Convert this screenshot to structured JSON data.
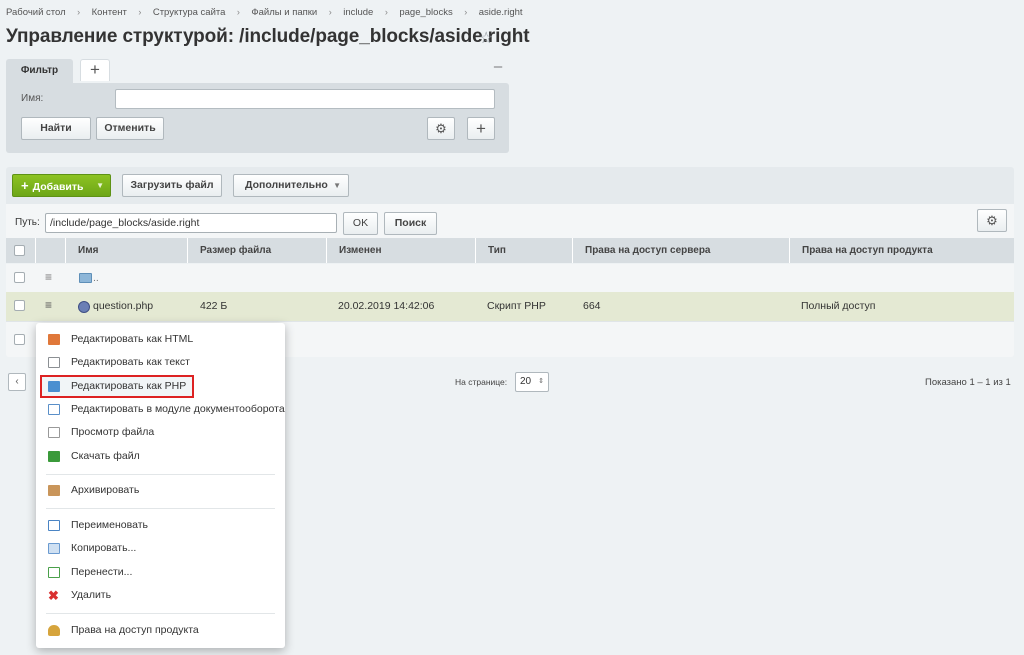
{
  "breadcrumbs": [
    "Рабочий стол",
    "Контент",
    "Структура сайта",
    "Файлы и папки",
    "include",
    "page_blocks",
    "aside.right"
  ],
  "page_title": "Управление структурой: /include/page_blocks/aside.right",
  "star_icon": "☆",
  "filter": {
    "tab_label": "Фильтр",
    "add_tab_icon": "+",
    "collapse_icon": "–",
    "name_label": "Имя:",
    "name_value": "",
    "find_label": "Найти",
    "cancel_label": "Отменить",
    "settings_icon": "⚙",
    "add_icon": "+"
  },
  "toolbar": {
    "add_label": "Добавить",
    "add_icon": "+",
    "add_caret": "▼",
    "upload_label": "Загрузить файл",
    "more_label": "Дополнительно",
    "more_caret": "▼"
  },
  "path": {
    "label": "Путь:",
    "value": "/include/page_blocks/aside.right",
    "ok_label": "OK",
    "search_label": "Поиск",
    "settings_icon": "⚙"
  },
  "grid": {
    "columns": [
      "Имя",
      "Размер файла",
      "Изменен",
      "Тип",
      "Права на доступ сервера",
      "Права на доступ продукта"
    ],
    "menu_icon": "≡",
    "parent_row": {
      "name": ".."
    },
    "rows": [
      {
        "name": "question.php",
        "size": "422 Б",
        "modified": "20.02.2019 14:42:06",
        "type": "Скрипт PHP",
        "server_rights": "664",
        "product_rights": "Полный доступ"
      }
    ]
  },
  "pager": {
    "prev_icon": "‹",
    "per_page_label": "На странице:",
    "per_page_value": "20",
    "per_page_caret": "⇕",
    "shown": "Показано 1 – 1 из 1"
  },
  "context_menu": {
    "items": [
      {
        "label": "Редактировать как HTML",
        "icon": "edit-html-icon",
        "color": "#e0783a"
      },
      {
        "label": "Редактировать как текст",
        "icon": "edit-text-icon",
        "color": "#8b8f93"
      },
      {
        "label": "Редактировать как PHP",
        "icon": "edit-php-icon",
        "color": "#4a8fd0",
        "selected": true
      },
      {
        "label": "Редактировать в модуле документооборота",
        "icon": "workflow-icon",
        "color": "#5a8fc8"
      },
      {
        "label": "Просмотр файла",
        "icon": "view-file-icon",
        "color": "#d8a020"
      },
      {
        "label": "Скачать файл",
        "icon": "download-icon",
        "color": "#3a9a3a"
      },
      {
        "label": "Архивировать",
        "icon": "archive-icon",
        "color": "#c9955a"
      },
      {
        "label": "Переименовать",
        "icon": "rename-icon",
        "color": "#4a84c4"
      },
      {
        "label": "Копировать...",
        "icon": "copy-icon",
        "color": "#6a9ad0"
      },
      {
        "label": "Перенести...",
        "icon": "move-icon",
        "color": "#4aa04a"
      },
      {
        "label": "Удалить",
        "icon": "delete-icon",
        "color": "#d93030"
      },
      {
        "label": "Права на доступ продукта",
        "icon": "permissions-icon",
        "color": "#d6a43c"
      }
    ]
  },
  "colors": {
    "accent_green": "#78b11b",
    "selected_row": "#e4e9d3",
    "highlight_outline": "#dd2222"
  }
}
